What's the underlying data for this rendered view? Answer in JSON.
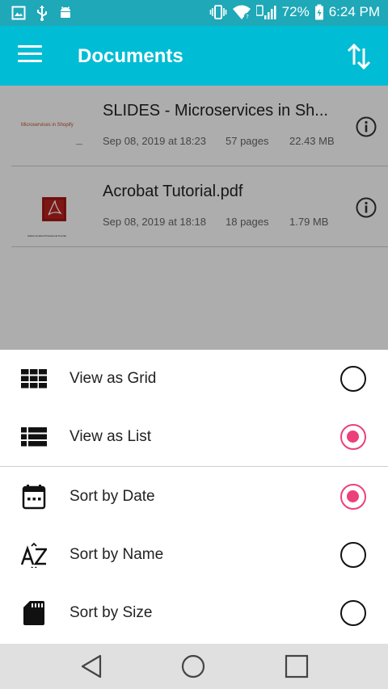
{
  "status_bar": {
    "battery": "72%",
    "time": "6:24 PM",
    "icons": [
      "image-icon",
      "usb-icon",
      "android-icon",
      "vibrate-icon",
      "wifi-icon",
      "signal-icon",
      "battery-icon"
    ]
  },
  "app_bar": {
    "title": "Documents",
    "menu_icon": "menu-icon",
    "sort_icon": "sort-arrows-icon"
  },
  "documents": [
    {
      "title": "SLIDES - Microservices in Sh...",
      "date": "Sep 08, 2019 at 18:23",
      "pages": "57 pages",
      "size": "22.43 MB",
      "thumb_text": "Microservices in Shopify",
      "thumb_sub": "—"
    },
    {
      "title": "Acrobat Tutorial.pdf",
      "date": "Sep 08, 2019 at 18:18",
      "pages": "18 pages",
      "size": "1.79 MB",
      "thumb_sub": "Adobe Acrobat Professional Tutorial"
    }
  ],
  "sheet": {
    "options": [
      {
        "label": "View as Grid",
        "icon": "grid-icon",
        "selected": false
      },
      {
        "label": "View as List",
        "icon": "list-icon",
        "selected": true
      },
      {
        "label": "Sort by Date",
        "icon": "calendar-icon",
        "selected": true
      },
      {
        "label": "Sort by Name",
        "icon": "az-sort-icon",
        "selected": false
      },
      {
        "label": "Sort by Size",
        "icon": "sd-card-icon",
        "selected": false
      }
    ]
  },
  "nav_bar": {
    "icons": [
      "back-icon",
      "home-icon",
      "recents-icon"
    ]
  },
  "colors": {
    "status_bar": "#1ea8b8",
    "app_bar": "#00bcd4",
    "accent": "#ec407a",
    "nav_bar": "#e0e0e0"
  }
}
